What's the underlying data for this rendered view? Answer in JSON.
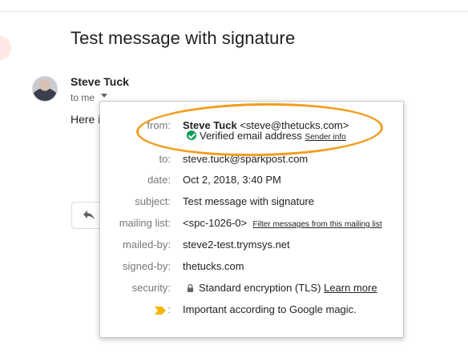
{
  "email": {
    "subject": "Test message with signature",
    "sender_name": "Steve Tuck",
    "recipient_short": "to me",
    "body_snippet": "Here i"
  },
  "details_popup": {
    "from": {
      "label": "from:",
      "name": "Steve Tuck",
      "address": "<steve@thetucks.com>",
      "verified_text": "Verified email address",
      "sender_info_link": "Sender info"
    },
    "to": {
      "label": "to:",
      "value": "steve.tuck@sparkpost.com"
    },
    "date": {
      "label": "date:",
      "value": "Oct 2, 2018, 3:40 PM"
    },
    "subject": {
      "label": "subject:",
      "value": "Test message with signature"
    },
    "mailing_list": {
      "label": "mailing list:",
      "value": "<spc-1026-0>",
      "filter_link": "Filter messages from this mailing list"
    },
    "mailed_by": {
      "label": "mailed-by:",
      "value": "steve2-test.trymsys.net"
    },
    "signed_by": {
      "label": "signed-by:",
      "value": "thetucks.com"
    },
    "security": {
      "label": "security:",
      "value": "Standard encryption (TLS)",
      "learn_more_link": "Learn more"
    },
    "importance": {
      "label": ":",
      "value": "Important according to Google magic."
    }
  },
  "colors": {
    "highlight_ellipse": "#f29d1e",
    "verified_check": "#0f9d58",
    "important_marker": "#f4b400"
  },
  "icons": [
    "reply-icon",
    "dropdown-caret-icon",
    "verified-check-icon",
    "lock-icon",
    "importance-marker-icon"
  ]
}
